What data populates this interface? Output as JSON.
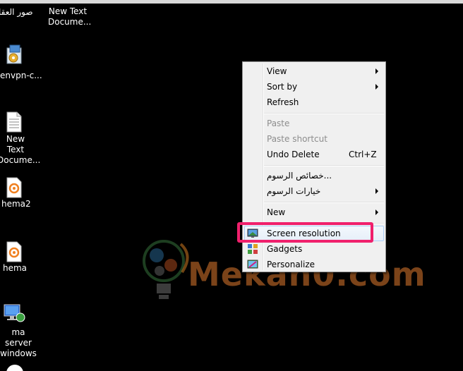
{
  "desktop": {
    "icons": [
      {
        "label": "صور العقا",
        "icon": "folder-icon"
      },
      {
        "label": "New Text Docume...",
        "icon": "text-file-icon"
      },
      {
        "label": "envpn-c...",
        "icon": "installer-icon"
      },
      {
        "label": "New Text Docume...",
        "icon": "text-file-icon"
      },
      {
        "label": "hema2",
        "icon": "app-file-icon"
      },
      {
        "label": "hema",
        "icon": "app-file-icon"
      },
      {
        "label": "ma server windows",
        "icon": "network-computer-icon"
      }
    ]
  },
  "watermark": {
    "text": "Mekan0.com",
    "color": "#96521e"
  },
  "context_menu": {
    "items": [
      {
        "label": "View",
        "submenu": true
      },
      {
        "label": "Sort by",
        "submenu": true
      },
      {
        "label": "Refresh"
      },
      {
        "label": "Paste",
        "disabled": true
      },
      {
        "label": "Paste shortcut",
        "disabled": true
      },
      {
        "label": "Undo Delete",
        "shortcut": "Ctrl+Z"
      },
      {
        "label": "خصائص الرسوم...",
        "submenu": false
      },
      {
        "label": "خيارات الرسوم",
        "submenu": true
      },
      {
        "label": "New",
        "submenu": true
      },
      {
        "label": "Screen resolution",
        "icon": "screen-resolution-icon"
      },
      {
        "label": "Gadgets",
        "icon": "gadgets-icon"
      },
      {
        "label": "Personalize",
        "icon": "personalize-icon"
      }
    ]
  },
  "highlight_color": "#f0206c"
}
